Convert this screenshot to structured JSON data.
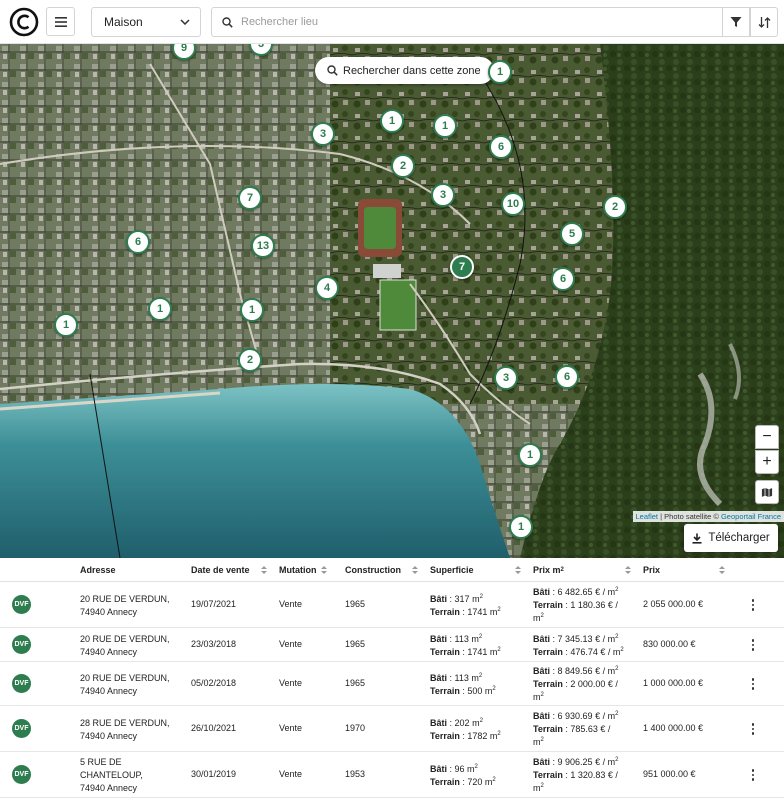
{
  "header": {
    "property_type": "Maison",
    "search_placeholder": "Rechercher lieu"
  },
  "map": {
    "search_zone_label": "Rechercher dans cette zone",
    "attribution_leaflet": "Leaflet",
    "attribution_mid": " | Photo satellite © ",
    "attribution_geoportail": "Geoportail France",
    "zoom_out": "−",
    "zoom_in": "+",
    "download_label": "Télécharger",
    "markers": [
      "9",
      "3",
      "1",
      "1",
      "1",
      "3",
      "6",
      "2",
      "3",
      "7",
      "10",
      "2",
      "6",
      "5",
      "13",
      "7",
      "6",
      "4",
      "1",
      "1",
      "1",
      "2",
      "3",
      "6",
      "1",
      "1"
    ]
  },
  "table": {
    "headers": {
      "address": "Adresse",
      "date": "Date de vente",
      "mutation": "Mutation",
      "construction": "Construction",
      "area": "Superficie",
      "price_m2": "Prix m",
      "price_m2_sup": "2",
      "price": "Prix"
    },
    "labels": {
      "bati": "Bâti",
      "terrain": "Terrain",
      "sep": " : ",
      "m": " m",
      "sq": "2",
      "per_m": " / m",
      "per": " /",
      "m_only": "m"
    },
    "rows": [
      {
        "badge": "DVF",
        "addr1": "20 RUE DE VERDUN,",
        "addr2": "74940 Annecy",
        "addr3": "",
        "date": "19/07/2021",
        "mutation": "Vente",
        "construction": "1965",
        "bati_area": "317",
        "terrain_area": "1741",
        "bati_price": "6 482.65 €",
        "terrain_price": "1 180.36 €",
        "price": "2 055 000.00 €"
      },
      {
        "badge": "DVF",
        "addr1": "20 RUE DE VERDUN,",
        "addr2": "74940 Annecy",
        "addr3": "",
        "date": "23/03/2018",
        "mutation": "Vente",
        "construction": "1965",
        "bati_area": "113",
        "terrain_area": "1741",
        "bati_price": "7 345.13 €",
        "terrain_price": "476.74 €",
        "price": "830 000.00 €"
      },
      {
        "badge": "DVF",
        "addr1": "20 RUE DE VERDUN,",
        "addr2": "74940 Annecy",
        "addr3": "",
        "date": "05/02/2018",
        "mutation": "Vente",
        "construction": "1965",
        "bati_area": "113",
        "terrain_area": "500",
        "bati_price": "8 849.56 €",
        "terrain_price": "2 000.00 €",
        "price": "1 000 000.00 €"
      },
      {
        "badge": "DVF",
        "addr1": "28 RUE DE VERDUN,",
        "addr2": "74940 Annecy",
        "addr3": "",
        "date": "26/10/2021",
        "mutation": "Vente",
        "construction": "1970",
        "bati_area": "202",
        "terrain_area": "1782",
        "bati_price": "6 930.69 €",
        "terrain_price": "785.63 €",
        "price": "1 400 000.00 €"
      },
      {
        "badge": "DVF",
        "addr1": "5 RUE DE",
        "addr2": "CHANTELOUP,",
        "addr3": "74940 Annecy",
        "date": "30/01/2019",
        "mutation": "Vente",
        "construction": "1953",
        "bati_area": "96",
        "terrain_area": "720",
        "bati_price": "9 906.25 €",
        "terrain_price": "1 320.83 €",
        "price": "951 000.00 €"
      }
    ]
  }
}
